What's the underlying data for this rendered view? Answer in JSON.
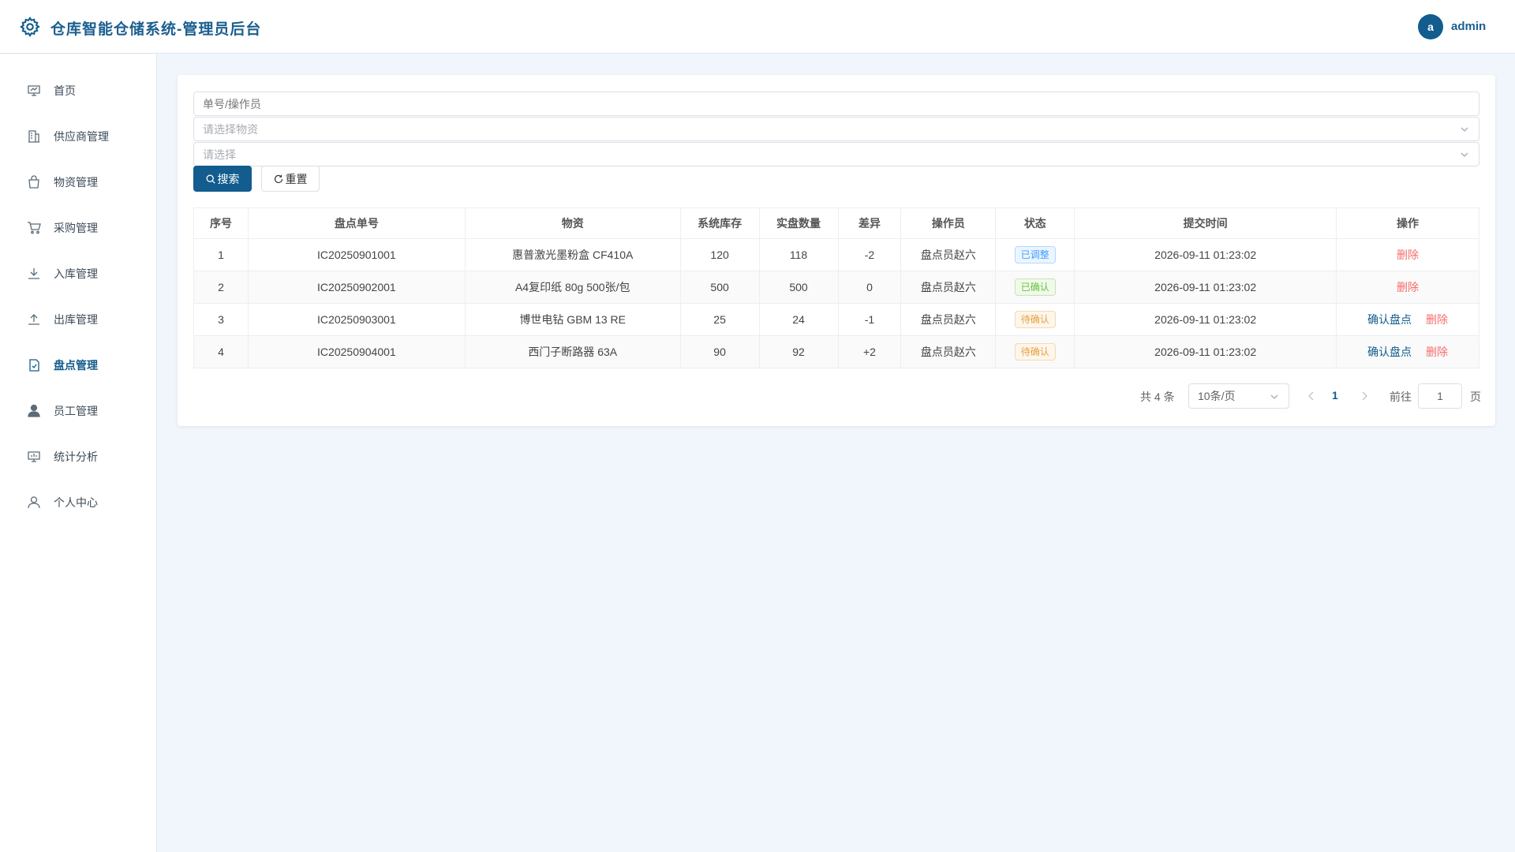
{
  "header": {
    "title": "仓库智能仓储系统-管理员后台",
    "avatar_letter": "a",
    "username": "admin"
  },
  "sidebar": {
    "items": [
      {
        "label": "首页",
        "icon": "dashboard-icon"
      },
      {
        "label": "供应商管理",
        "icon": "building-icon"
      },
      {
        "label": "物资管理",
        "icon": "bag-icon"
      },
      {
        "label": "采购管理",
        "icon": "cart-icon"
      },
      {
        "label": "入库管理",
        "icon": "download-icon"
      },
      {
        "label": "出库管理",
        "icon": "upload-icon"
      },
      {
        "label": "盘点管理",
        "icon": "checklist-icon"
      },
      {
        "label": "员工管理",
        "icon": "user-solid-icon"
      },
      {
        "label": "统计分析",
        "icon": "chart-icon"
      },
      {
        "label": "个人中心",
        "icon": "user-outline-icon"
      }
    ],
    "active_index": 6
  },
  "filters": {
    "keyword_placeholder": "单号/操作员",
    "material_placeholder": "请选择物资",
    "status_placeholder": "请选择",
    "search_label": "搜索",
    "reset_label": "重置"
  },
  "table": {
    "headers": [
      "序号",
      "盘点单号",
      "物资",
      "系统库存",
      "实盘数量",
      "差异",
      "操作员",
      "状态",
      "提交时间",
      "操作"
    ],
    "rows": [
      {
        "idx": "1",
        "no": "IC20250901001",
        "material": "惠普激光墨粉盒 CF410A",
        "system": "120",
        "actual": "118",
        "diff": "-2",
        "operator": "盘点员赵六",
        "status": "已调整",
        "time": "2026-09-11 01:23:02",
        "confirm": "",
        "delete": "删除"
      },
      {
        "idx": "2",
        "no": "IC20250902001",
        "material": "A4复印纸 80g 500张/包",
        "system": "500",
        "actual": "500",
        "diff": "0",
        "operator": "盘点员赵六",
        "status": "已确认",
        "time": "2026-09-11 01:23:02",
        "confirm": "",
        "delete": "删除"
      },
      {
        "idx": "3",
        "no": "IC20250903001",
        "material": "博世电钻 GBM 13 RE",
        "system": "25",
        "actual": "24",
        "diff": "-1",
        "operator": "盘点员赵六",
        "status": "待确认",
        "time": "2026-09-11 01:23:02",
        "confirm": "确认盘点",
        "delete": "删除"
      },
      {
        "idx": "4",
        "no": "IC20250904001",
        "material": "西门子断路器 63A",
        "system": "90",
        "actual": "92",
        "diff": "+2",
        "operator": "盘点员赵六",
        "status": "待确认",
        "time": "2026-09-11 01:23:02",
        "confirm": "确认盘点",
        "delete": "删除"
      }
    ]
  },
  "pagination": {
    "total_text": "共 4 条",
    "page_size": "10条/页",
    "current_page": "1",
    "goto_label": "前往",
    "goto_value": "1",
    "page_unit": "页"
  },
  "colors": {
    "primary": "#125c8e",
    "danger": "#f56c6c",
    "success": "#67c23a",
    "warning": "#e6a23c",
    "info": "#409eff"
  }
}
